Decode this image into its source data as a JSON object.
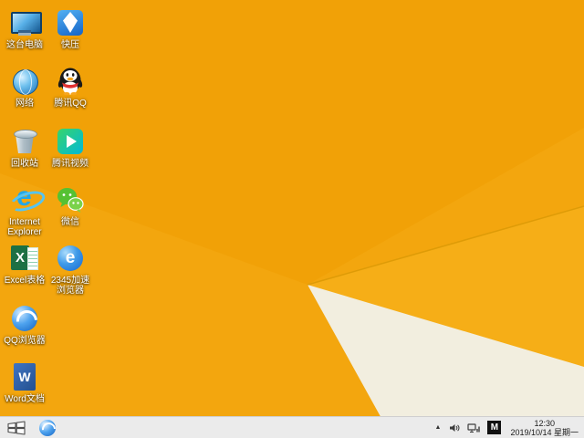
{
  "colors": {
    "wallpaper_base": "#F3A60E",
    "wallpaper_facet_top": "#F1A107",
    "wallpaper_facet_light": "#F6AE17",
    "wallpaper_cream": "#F2EEDF",
    "wallpaper_crease": "#DE9B07"
  },
  "desktop": {
    "icons": [
      {
        "name": "this-pc",
        "label": "这台电脑"
      },
      {
        "name": "network",
        "label": "网络"
      },
      {
        "name": "recycle-bin",
        "label": "回收站"
      },
      {
        "name": "internet-explorer",
        "label": "Internet Explorer"
      },
      {
        "name": "excel",
        "label": "Excel表格"
      },
      {
        "name": "qq-browser",
        "label": "QQ浏览器"
      },
      {
        "name": "word",
        "label": "Word文档"
      },
      {
        "name": "kuaiya",
        "label": "快压"
      },
      {
        "name": "tencent-qq",
        "label": "腾讯QQ"
      },
      {
        "name": "tencent-video",
        "label": "腾讯视频"
      },
      {
        "name": "wechat",
        "label": "微信"
      },
      {
        "name": "browser-2345",
        "label": "2345加速浏览器"
      }
    ]
  },
  "taskbar": {
    "pinned": [
      {
        "name": "qq-browser-pinned",
        "label": "QQ浏览器"
      }
    ],
    "tray": {
      "hidden_icons_glyph": "▲",
      "ime_badge": "M",
      "clock": {
        "time": "12:30",
        "date": "2019/10/14 星期一"
      }
    }
  }
}
